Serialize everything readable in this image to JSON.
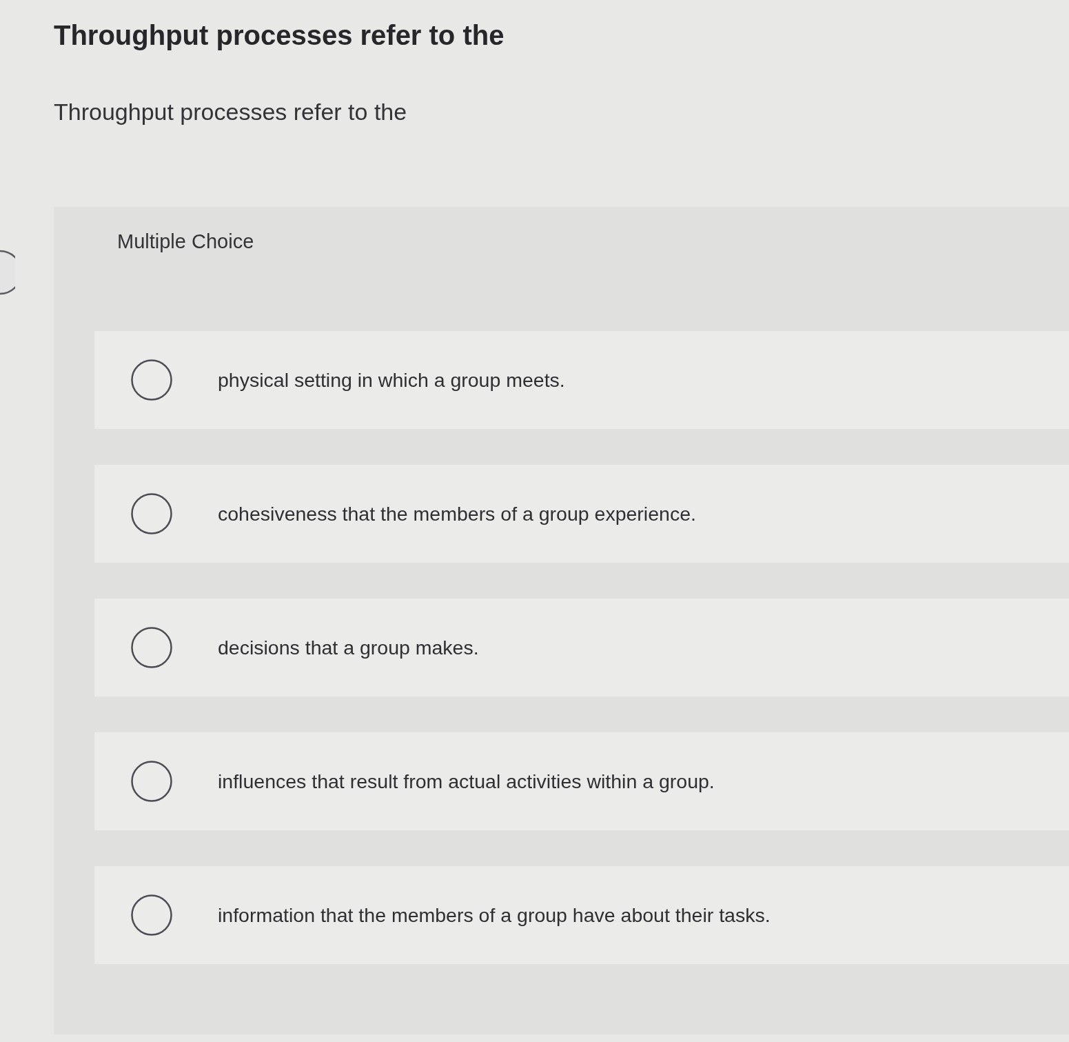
{
  "title": "Throughput processes refer to the",
  "question": "Throughput processes refer to the",
  "panel": {
    "heading": "Multiple Choice",
    "options": [
      {
        "text": "physical setting in which a group meets.",
        "selected": false
      },
      {
        "text": "cohesiveness that the members of a group experience.",
        "selected": false
      },
      {
        "text": "decisions that a group makes.",
        "selected": false
      },
      {
        "text": "influences that result from actual activities within a group.",
        "selected": false
      },
      {
        "text": "information that the members of a group have about their tasks.",
        "selected": false
      }
    ]
  }
}
